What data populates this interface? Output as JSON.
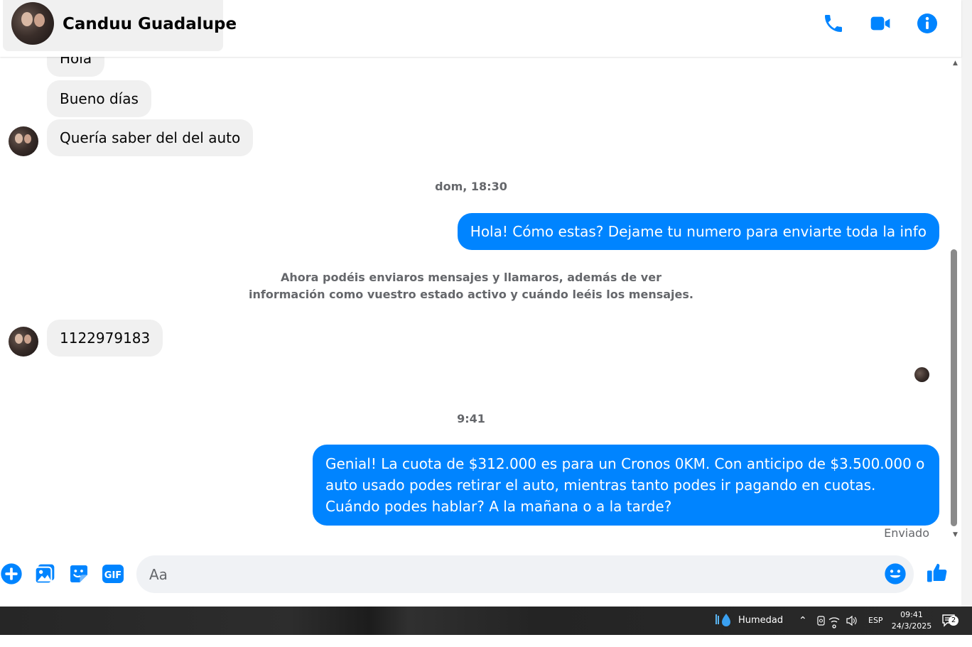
{
  "header": {
    "contact_name": "Canduu Guadalupe",
    "icons": [
      "phone-icon",
      "video-call-icon",
      "info-icon"
    ]
  },
  "colors": {
    "accent": "#0084ff",
    "incoming_bubble": "#f0f0f0",
    "secondary_text": "#65676b"
  },
  "messages": {
    "in_1": "Hola",
    "in_2": "Bueno días",
    "in_3": "Quería saber del del auto",
    "time_1": "dom, 18:30",
    "out_1": "Hola! Cómo estas? Dejame tu numero para enviarte toda la info",
    "system_note": "Ahora podéis enviaros mensajes y llamaros, además de ver información como vuestro estado activo y cuándo leéis los mensajes.",
    "in_4": "1122979183",
    "time_2": "9:41",
    "out_2": "Genial! La cuota de $312.000 es para un Cronos 0KM. Con anticipo de $3.500.000 o auto usado podes retirar el auto, mientras tanto podes ir pagando en cuotas. Cuándo podes hablar? A la mañana o a la tarde?",
    "status": "Enviado"
  },
  "composer": {
    "placeholder": "Aa",
    "icons": [
      "add-icon",
      "photo-icon",
      "sticker-icon",
      "gif-icon",
      "emoji-icon",
      "like-icon"
    ],
    "gif_label": "GIF"
  },
  "taskbar": {
    "weather": "Humedad",
    "language": "ESP",
    "time": "09:41",
    "date": "24/3/2025",
    "notification_count": "2"
  }
}
